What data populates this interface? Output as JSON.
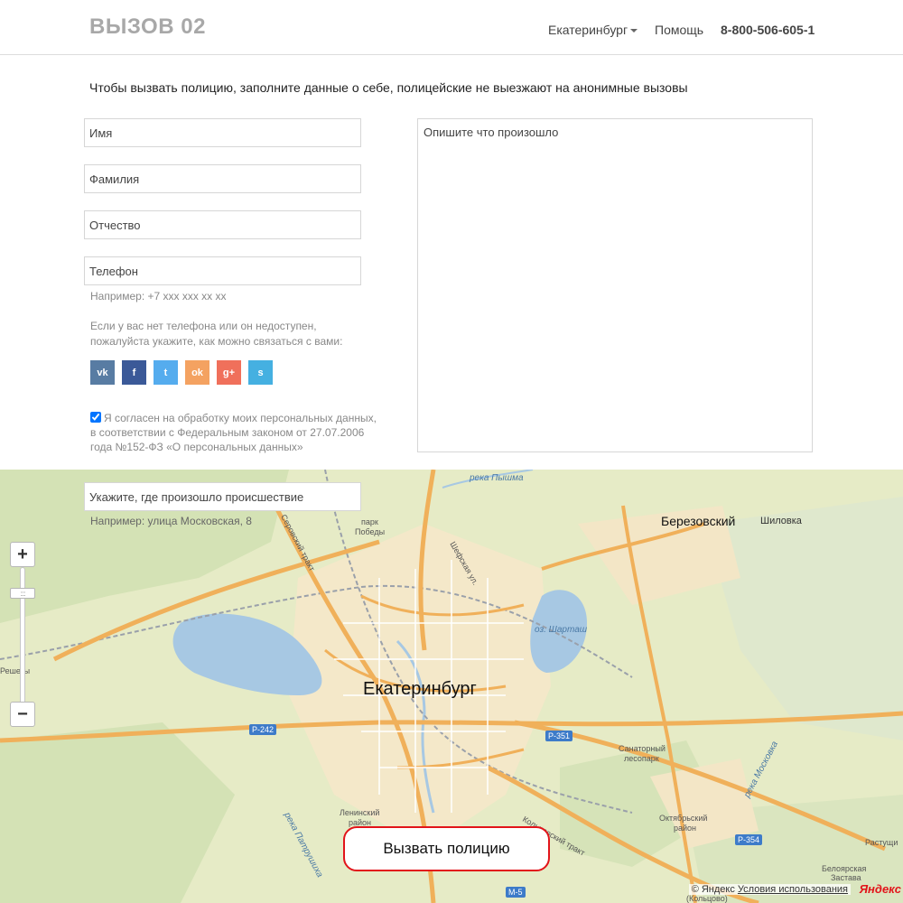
{
  "header": {
    "logo": "ВЫЗОВ 02",
    "city": "Екатеринбург",
    "help": "Помощь",
    "phone": "8-800-506-605-1"
  },
  "form": {
    "intro": "Чтобы вызвать полицию, заполните данные о себе, полицейские не выезжают на анонимные вызовы",
    "first_name_placeholder": "Имя",
    "last_name_placeholder": "Фамилия",
    "patronymic_placeholder": "Отчество",
    "phone_placeholder": "Телефон",
    "phone_hint": "Например: +7 xxx xxx xx xx",
    "contact_hint_line1": "Если у вас нет телефона или он недоступен,",
    "contact_hint_line2": "пожалуйста укажите, как можно связаться с вами:",
    "social": [
      {
        "label": "vk",
        "color": "#587ca3"
      },
      {
        "label": "f",
        "color": "#3b5998"
      },
      {
        "label": "t",
        "color": "#55acee"
      },
      {
        "label": "ok",
        "color": "#f4a261"
      },
      {
        "label": "g+",
        "color": "#f0705b"
      },
      {
        "label": "s",
        "color": "#45b0e1"
      }
    ],
    "consent_checked": true,
    "consent_line1": "Я согласен на обработку моих персональных данных,",
    "consent_line2": "в соответствии с Федеральным законом от 27.07.2006",
    "consent_line3": "года №152-ФЗ «О персональных данных»",
    "description_placeholder": "Опишите что произошло"
  },
  "map": {
    "search_placeholder": "Укажите, где произошло происшествие",
    "search_hint": "Например: улица Московская, 8",
    "zoom_in": "+",
    "zoom_out": "−",
    "labels": {
      "city": "Екатеринбург",
      "berezovsky": "Березовский",
      "shilovka": "Шиловка",
      "park": "парк",
      "pobedy": "Победы",
      "serovsky": "Серовский тракт",
      "shefskaya": "Шефская ул.",
      "river_pyshma": "река Пышма",
      "lake_shartash": "оз. Шарташ",
      "sanatorny1": "Санаторный",
      "sanatorny2": "лесопарк",
      "leninsky1": "Ленинский",
      "leninsky2": "район",
      "river_patrushikha": "река Патрушиха",
      "koltsovsky": "Кольцовский тракт",
      "river_moskovka": "река Московка",
      "oktyabrsky1": "Октябрьский",
      "oktyabrsky2": "район",
      "rastushi": "Растущи",
      "beloyarskaya1": "Белоярская",
      "beloyarskaya2": "Застава",
      "reshety": "Решеты",
      "koltsovo": "(Кольцово)"
    },
    "routes": {
      "r242": "Р-242",
      "r351": "Р-351",
      "r354": "Р-354",
      "m5": "М-5"
    },
    "copyright_prefix": "© Яндекс",
    "terms": "Условия использования",
    "yandex": "Яндекс"
  },
  "cta": "Вызвать полицию"
}
